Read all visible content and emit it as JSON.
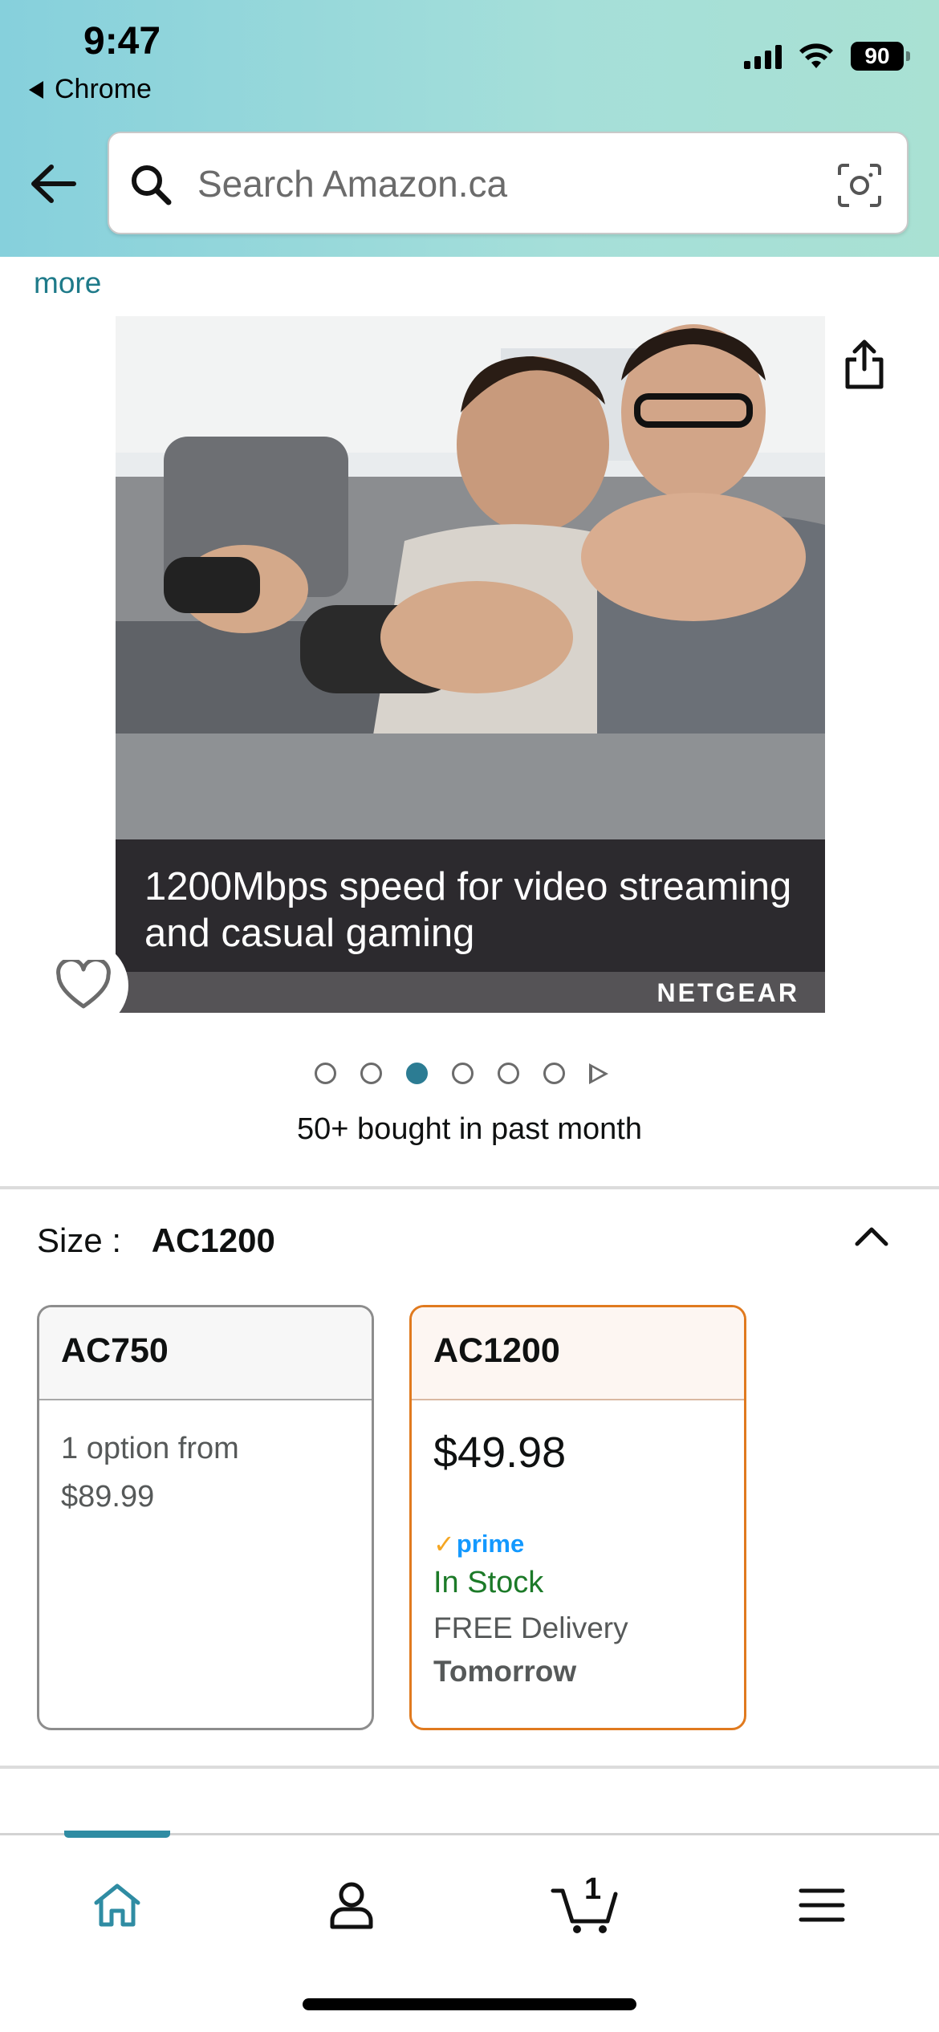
{
  "status_bar": {
    "time": "9:47",
    "back_app": "Chrome",
    "battery": "90"
  },
  "search": {
    "placeholder": "Search Amazon.ca"
  },
  "description": {
    "more_link": "more"
  },
  "product_image": {
    "caption": "1200Mbps speed for video streaming and casual gaming",
    "brand": "NETGEAR",
    "carousel_total": 6,
    "carousel_active_index": 2
  },
  "social_proof": "50+ bought in past month",
  "size_selector": {
    "label": "Size :",
    "selected": "AC1200",
    "options": [
      {
        "name": "AC750",
        "line1": "1 option from",
        "line2": "$89.99"
      },
      {
        "name": "AC1200",
        "price": "$49.98",
        "prime": "prime",
        "stock": "In Stock",
        "delivery": "FREE Delivery",
        "delivery_day": "Tomorrow"
      }
    ]
  },
  "bottom_nav": {
    "cart_count": "1",
    "items": [
      "home-icon",
      "account-icon",
      "cart-icon",
      "menu-icon"
    ]
  },
  "colors": {
    "accent_teal": "#2f8ca3",
    "selected_border": "#e07a1f",
    "in_stock_green": "#1c7a28",
    "prime_blue": "#1399ff"
  }
}
